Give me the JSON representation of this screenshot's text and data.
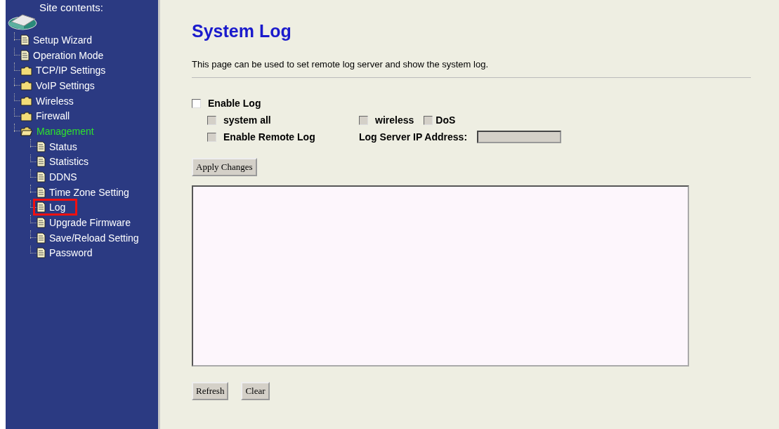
{
  "sidebar": {
    "title": "Site contents:",
    "items": [
      {
        "label": "Setup Wizard",
        "kind": "page",
        "selected": false,
        "highlighted": false
      },
      {
        "label": "Operation Mode",
        "kind": "page",
        "selected": false,
        "highlighted": false
      },
      {
        "label": "TCP/IP Settings",
        "kind": "folder",
        "expanded": false,
        "selected": false,
        "highlighted": false
      },
      {
        "label": "VoIP Settings",
        "kind": "folder",
        "expanded": false,
        "selected": false,
        "highlighted": false
      },
      {
        "label": "Wireless",
        "kind": "folder",
        "expanded": false,
        "selected": false,
        "highlighted": false
      },
      {
        "label": "Firewall",
        "kind": "folder",
        "expanded": false,
        "selected": false,
        "highlighted": false
      },
      {
        "label": "Management",
        "kind": "folder",
        "expanded": true,
        "selected": true,
        "highlighted": false,
        "children": [
          {
            "label": "Status",
            "kind": "page",
            "selected": false,
            "highlighted": false
          },
          {
            "label": "Statistics",
            "kind": "page",
            "selected": false,
            "highlighted": false
          },
          {
            "label": "DDNS",
            "kind": "page",
            "selected": false,
            "highlighted": false
          },
          {
            "label": "Time Zone Setting",
            "kind": "page",
            "selected": false,
            "highlighted": false
          },
          {
            "label": "Log",
            "kind": "page",
            "selected": false,
            "highlighted": true
          },
          {
            "label": "Upgrade Firmware",
            "kind": "page",
            "selected": false,
            "highlighted": false
          },
          {
            "label": "Save/Reload Setting",
            "kind": "page",
            "selected": false,
            "highlighted": false
          },
          {
            "label": "Password",
            "kind": "page",
            "selected": false,
            "highlighted": false
          }
        ]
      }
    ]
  },
  "page": {
    "title": "System Log",
    "description": "This page can be used to set remote log server and show the system log.",
    "enable_log": {
      "label": "Enable Log",
      "checked": false,
      "disabled": false
    },
    "system_all": {
      "label": "system all",
      "checked": false,
      "disabled": true
    },
    "wireless": {
      "label": "wireless",
      "checked": false,
      "disabled": true
    },
    "dos": {
      "label": "DoS",
      "checked": false,
      "disabled": true
    },
    "enable_remote_log": {
      "label": "Enable Remote Log",
      "checked": false,
      "disabled": true
    },
    "log_server": {
      "label": "Log Server IP Address:",
      "disabled": true
    },
    "apply_button": "Apply Changes",
    "buttons": [
      "Refresh",
      "Clear"
    ]
  }
}
